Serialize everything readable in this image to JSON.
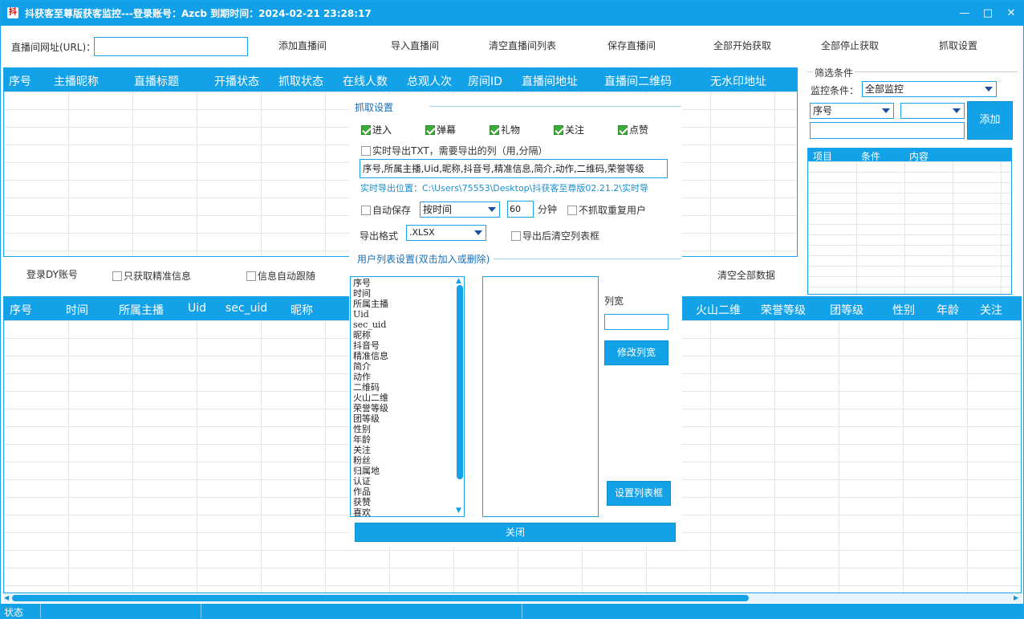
{
  "window": {
    "title": "抖获客至尊版获客监控---登录账号：Azcb   到期时间：2024-02-21 23:28:17",
    "logo": "抖"
  },
  "toolbar": {
    "url_label": "直播间网址(URL)：",
    "url_value": "",
    "add": "添加直播间",
    "import": "导入直播间",
    "clear": "清空直播间列表",
    "save": "保存直播间",
    "start_all": "全部开始获取",
    "stop_all": "全部停止获取",
    "settings": "抓取设置"
  },
  "room_grid": {
    "columns": [
      "序号",
      "主播昵称",
      "直播标题",
      "开播状态",
      "抓取状态",
      "在线人数",
      "总观人次",
      "房间ID",
      "直播间地址",
      "直播间二维码",
      "无水印地址"
    ]
  },
  "filter": {
    "group_title": "筛选条件",
    "cond_label": "监控条件：",
    "cond_value": "全部监控",
    "field_value": "序号",
    "op_value": "",
    "text_value": "",
    "add_button": "添加",
    "columns": [
      "项目",
      "条件",
      "内容"
    ]
  },
  "midbar": {
    "login": "登录DY账号",
    "precise": "只获取精准信息",
    "follow": "信息自动跟随",
    "clear_all": "清空全部数据"
  },
  "user_grid": {
    "columns_left": [
      "序号",
      "时间",
      "所属主播",
      "Uid",
      "sec_uid",
      "昵称"
    ],
    "columns_right": [
      "火山二维",
      "荣誉等级",
      "团等级",
      "性别",
      "年龄",
      "关注"
    ]
  },
  "dialog": {
    "section_title": "抓取设置",
    "checks": [
      {
        "label": "进入",
        "checked": true
      },
      {
        "label": "弹幕",
        "checked": true
      },
      {
        "label": "礼物",
        "checked": true
      },
      {
        "label": "关注",
        "checked": true
      },
      {
        "label": "点赞",
        "checked": true
      }
    ],
    "export_txt_label": "实时导出TXT，需要导出的列（用,分隔）",
    "export_cols": "序号,所属主播,Uid,昵称,抖音号,精准信息,简介,动作,二维码,荣誉等级",
    "export_path": "实时导出位置：C:\\Users\\75553\\Desktop\\抖获客至尊版02.21.2\\实时导",
    "autosave_label": "自动保存",
    "autosave_mode": "按时间",
    "minutes_value": "60",
    "minutes_unit": "分钟",
    "no_dup_label": "不抓取重复用户",
    "format_label": "导出格式",
    "format_value": ".XLSX",
    "clear_after_label": "导出后清空列表框",
    "user_list_title": "用户列表设置(双击加入或删除)",
    "columns_list": [
      "序号",
      "时间",
      "所属主播",
      "Uid",
      "sec_uid",
      "昵称",
      "抖音号",
      "精准信息",
      "简介",
      "动作",
      "二维码",
      "火山二维",
      "荣誉等级",
      "团等级",
      "性别",
      "年龄",
      "关注",
      "粉丝",
      "归属地",
      "认证",
      "作品",
      "获赞",
      "喜欢"
    ],
    "col_width_label": "列宽",
    "col_width_value": "",
    "modify_width": "修改列宽",
    "set_list": "设置列表框",
    "close": "关闭"
  },
  "status": {
    "label": "状态"
  },
  "colors": {
    "accent": "#13a2e8",
    "check": "#3caa3c"
  }
}
